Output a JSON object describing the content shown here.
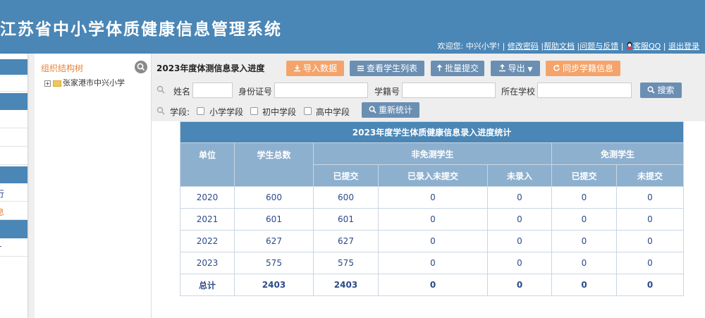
{
  "header": {
    "title": "江苏省中小学体质健康信息管理系统",
    "welcome": "欢迎您: 中兴小学! |",
    "links": [
      "修改密码",
      "帮助文档",
      "问题与反馈",
      "客服QQ",
      "退出登录"
    ]
  },
  "sidebar": {
    "partial_items": [
      "行",
      "息",
      "-"
    ]
  },
  "tree": {
    "title": "组织结构树",
    "node": "张家港市中兴小学"
  },
  "toolbar": {
    "page_title": "2023年度体测信息录入进度",
    "buttons": {
      "import": "导入数据",
      "students": "查看学生列表",
      "batch_submit": "批量提交",
      "export": "导出",
      "sync": "同步学籍信息"
    },
    "filters": {
      "name_label": "姓名",
      "id_label": "身份证号",
      "student_no_label": "学籍号",
      "school_label": "所在学校",
      "search": "搜索",
      "stage_label": "学段:",
      "stages": [
        "小学学段",
        "初中学段",
        "高中学段"
      ],
      "recount": "重新统计"
    }
  },
  "table": {
    "caption": "2023年度学生体质健康信息录入进度统计",
    "headers": {
      "unit": "单位",
      "total_students": "学生总数",
      "non_exempt": "非免测学生",
      "exempt": "免测学生",
      "submitted": "已提交",
      "entered_not_submitted": "已录入未提交",
      "not_entered": "未录入",
      "exempt_submitted": "已提交",
      "exempt_not_submitted": "未提交"
    },
    "rows": [
      [
        "2020",
        "600",
        "600",
        "0",
        "0",
        "0",
        "0"
      ],
      [
        "2021",
        "601",
        "601",
        "0",
        "0",
        "0",
        "0"
      ],
      [
        "2022",
        "627",
        "627",
        "0",
        "0",
        "0",
        "0"
      ],
      [
        "2023",
        "575",
        "575",
        "0",
        "0",
        "0",
        "0"
      ]
    ],
    "total": [
      "总计",
      "2403",
      "2403",
      "0",
      "0",
      "0",
      "0"
    ]
  },
  "colors": {
    "header": "#4a86b6",
    "orange_button": "#f4a46b",
    "blue_button": "#6b8fb3",
    "table_header": "#8eb0cf",
    "tree_title": "#e8833a"
  },
  "icons": [
    "search-icon",
    "folder-icon",
    "import-icon",
    "list-icon",
    "upload-icon",
    "export-icon",
    "sync-icon",
    "qq-icon"
  ]
}
